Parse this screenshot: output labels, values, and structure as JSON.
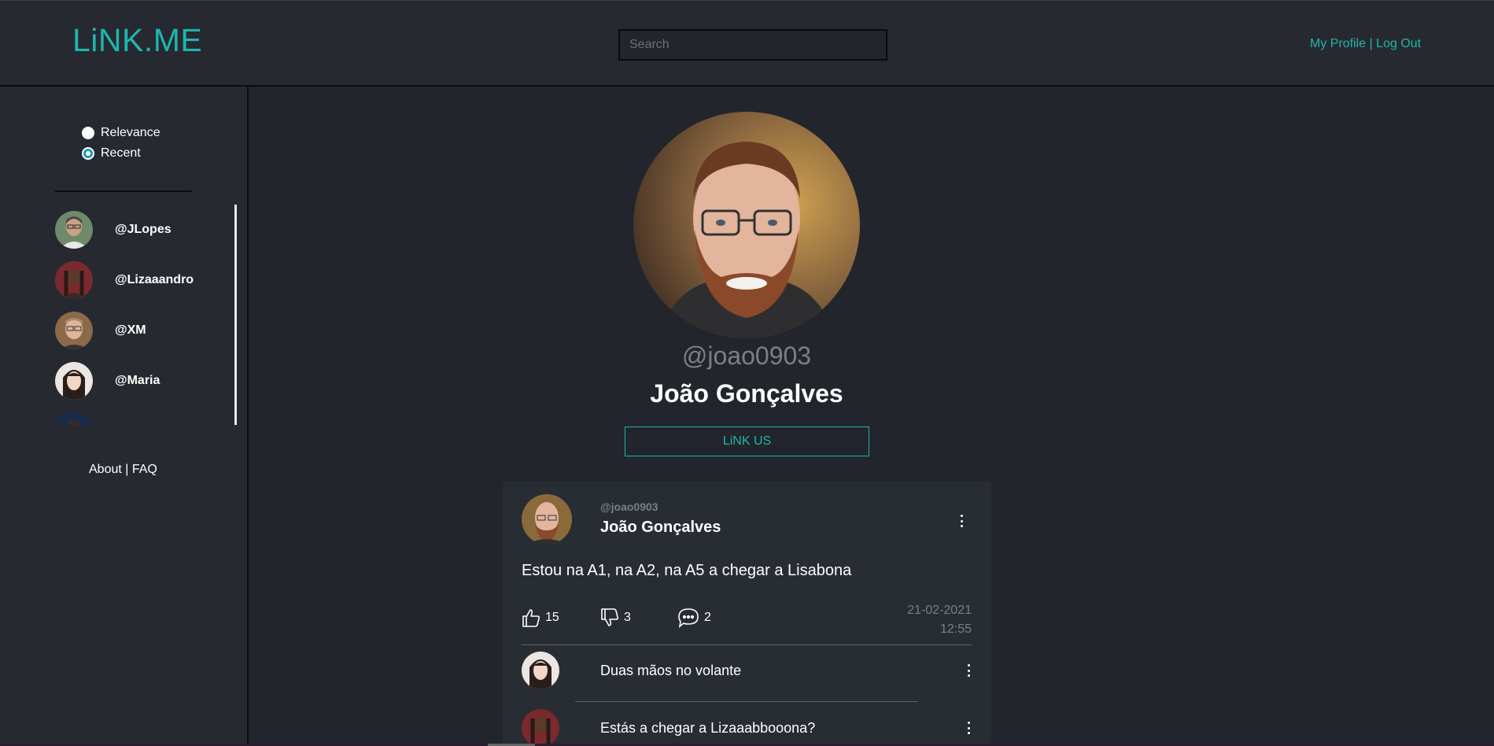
{
  "header": {
    "logo": "LiNK.ME",
    "search_placeholder": "Search",
    "my_profile": "My Profile",
    "separator": " | ",
    "log_out": "Log Out"
  },
  "sidebar": {
    "sort_options": [
      {
        "label": "Relevance",
        "selected": false
      },
      {
        "label": "Recent",
        "selected": true
      }
    ],
    "users": [
      {
        "handle": "@JLopes"
      },
      {
        "handle": "@Lizaaandro"
      },
      {
        "handle": "@XM"
      },
      {
        "handle": "@Maria"
      }
    ],
    "about": "About",
    "separator": " | ",
    "faq": "FAQ"
  },
  "profile": {
    "handle": "@joao0903",
    "name": "João Gonçalves",
    "link_button": "LiNK US"
  },
  "post": {
    "handle": "@joao0903",
    "name": "João Gonçalves",
    "text": "Estou na A1, na A2, na A5 a chegar a Lisabona",
    "likes": "15",
    "dislikes": "3",
    "comments_count": "2",
    "date": "21-02-2021",
    "time": "12:55",
    "comments": [
      {
        "text": "Duas mãos no volante"
      },
      {
        "text": "Estás a chegar a Lizaaabbooona?"
      }
    ]
  },
  "colors": {
    "accent": "#1fb5ad",
    "background": "#22252b",
    "panel": "#262a30",
    "muted": "#7a8088"
  }
}
